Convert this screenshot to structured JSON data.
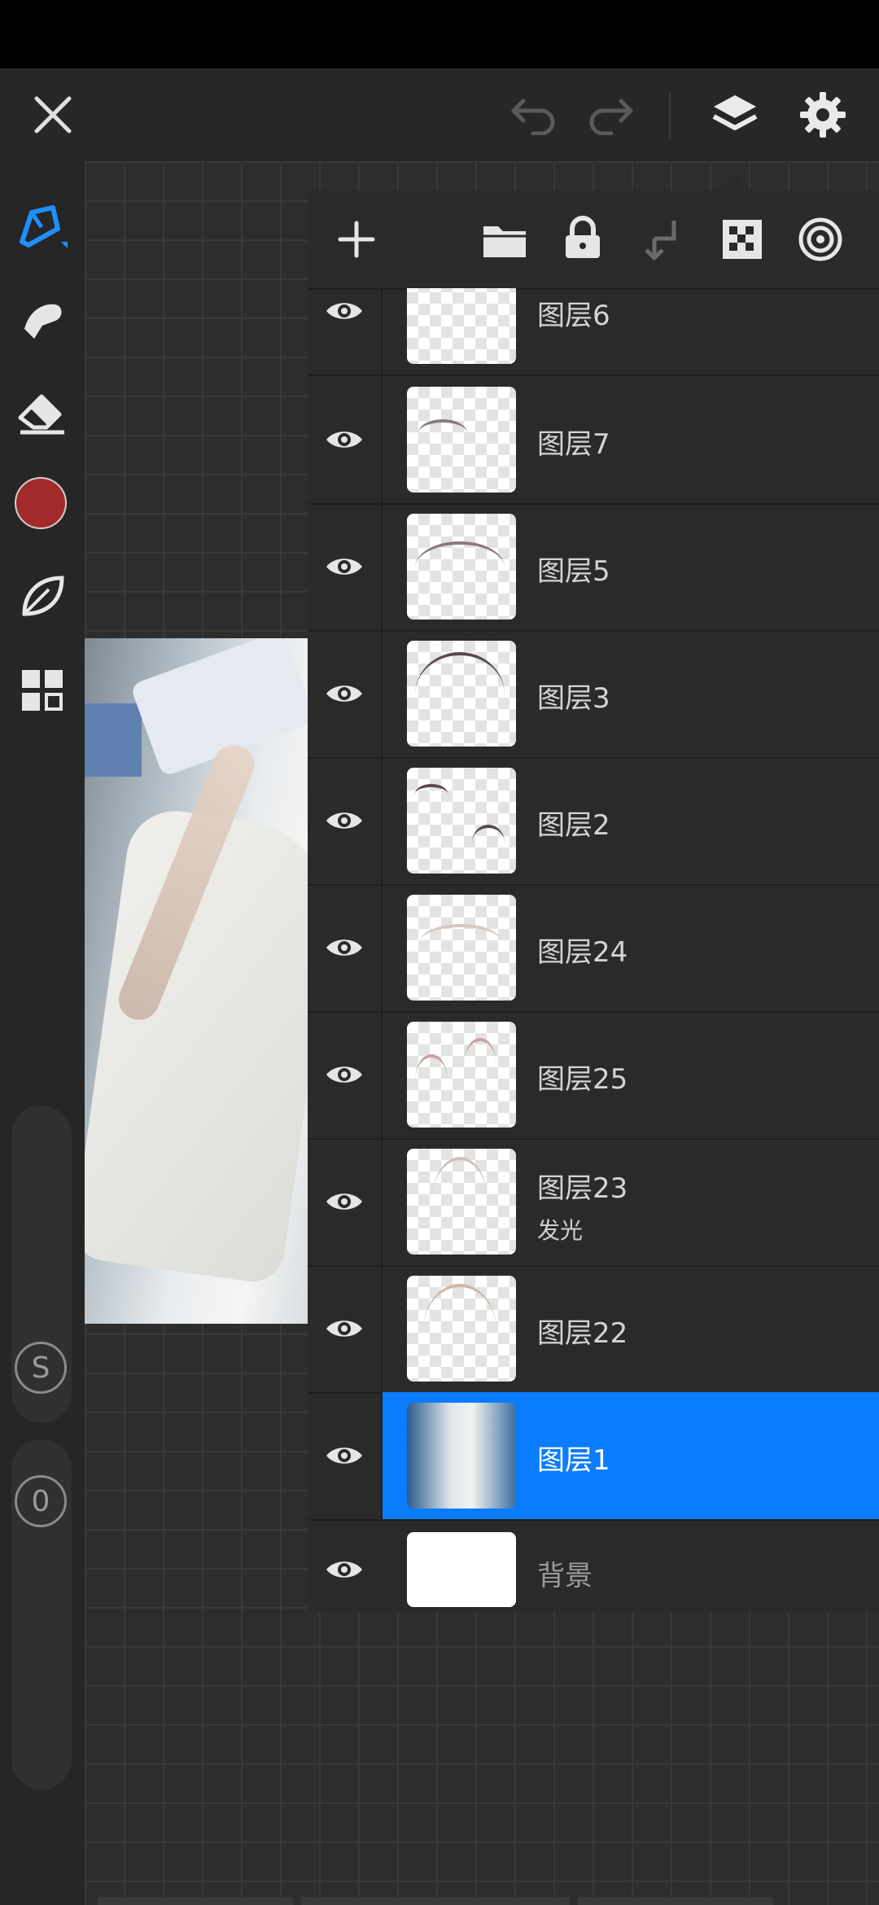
{
  "app": {
    "colors": {
      "accent": "#0a7cff",
      "brush_color": "#a32a2a",
      "panel": "#2a2a2a",
      "canvas": "#2d2d2d"
    }
  },
  "topbar": {
    "icons": [
      "close-icon",
      "undo-icon",
      "redo-icon",
      "layers-icon",
      "settings-icon"
    ]
  },
  "toolbar_left": {
    "tools": [
      "brush-icon",
      "smudge-icon",
      "eraser-icon",
      "color-swatch",
      "leaf-icon",
      "grid-icon"
    ],
    "size_label": "S",
    "opacity_label": "0"
  },
  "layer_panel": {
    "actions": [
      "add-icon",
      "folder-icon",
      "lock-icon",
      "merge-down-icon",
      "checker-icon",
      "blend-icon"
    ],
    "layers": [
      {
        "name": "图层6",
        "visible": true
      },
      {
        "name": "图层7",
        "visible": true
      },
      {
        "name": "图层5",
        "visible": true
      },
      {
        "name": "图层3",
        "visible": true
      },
      {
        "name": "图层2",
        "visible": true
      },
      {
        "name": "图层24",
        "visible": true
      },
      {
        "name": "图层25",
        "visible": true
      },
      {
        "name": "图层23",
        "blend": "发光",
        "visible": true
      },
      {
        "name": "图层22",
        "visible": true
      },
      {
        "name": "图层1",
        "visible": true,
        "selected": true
      },
      {
        "name": "背景",
        "visible": true
      }
    ]
  }
}
